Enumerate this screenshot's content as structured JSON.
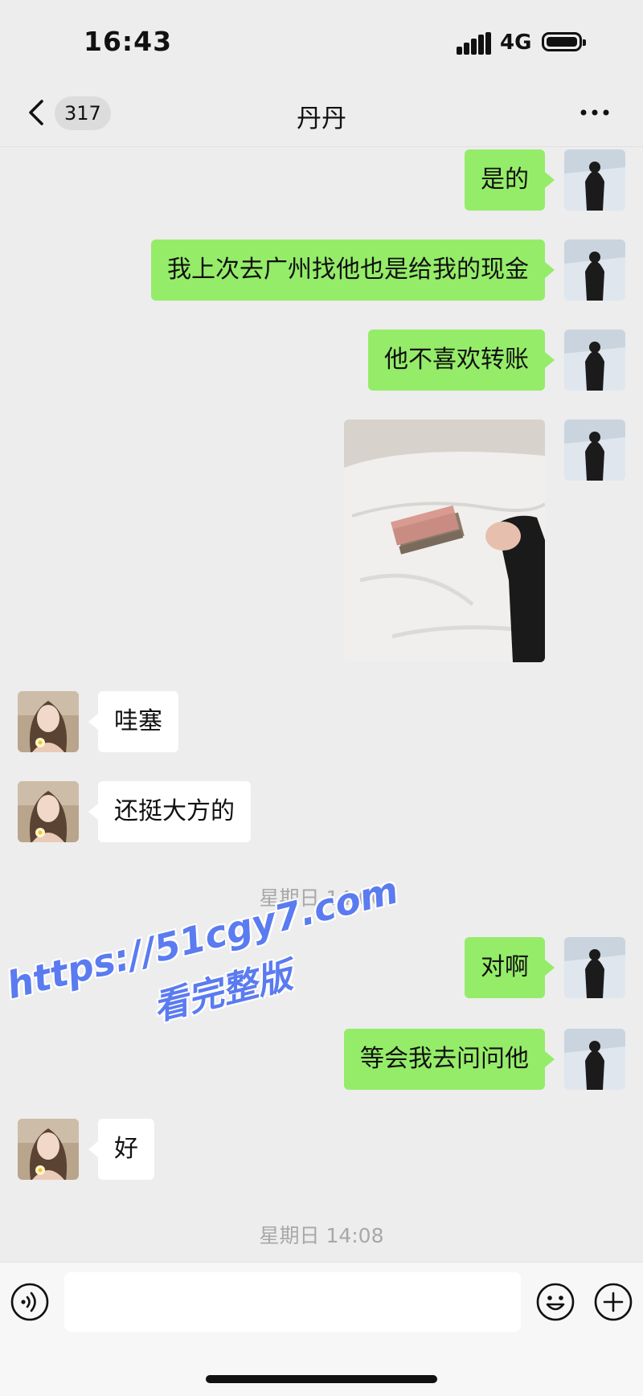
{
  "status_bar": {
    "time": "16:43",
    "network": "4G"
  },
  "nav": {
    "unread_count": "317",
    "title": "丹丹"
  },
  "messages": [
    {
      "side": "me",
      "text": "是的"
    },
    {
      "side": "me",
      "text": "我上次去广州找他也是给我的现金"
    },
    {
      "side": "me",
      "text": "他不喜欢转账"
    },
    {
      "side": "me",
      "type": "image"
    },
    {
      "side": "other",
      "text": "哇塞"
    },
    {
      "side": "other",
      "text": "还挺大方的"
    },
    {
      "type": "timestamp",
      "text": "星期日 14:06"
    },
    {
      "side": "me",
      "text": "对啊"
    },
    {
      "side": "me",
      "text": "等会我去问问他"
    },
    {
      "side": "other",
      "text": "好"
    },
    {
      "type": "timestamp",
      "text": "星期日 14:08"
    }
  ],
  "watermark": {
    "line1": "https://51cgy7.com",
    "line2": "看完整版"
  },
  "input_bar": {
    "placeholder": ""
  },
  "colors": {
    "background": "#ededed",
    "my_bubble": "#95ec69",
    "other_bubble": "#ffffff",
    "watermark": "#5b7bf0"
  },
  "icons": [
    "back-chevron-icon",
    "more-dots-icon",
    "voice-icon",
    "emoji-icon",
    "plus-icon"
  ]
}
